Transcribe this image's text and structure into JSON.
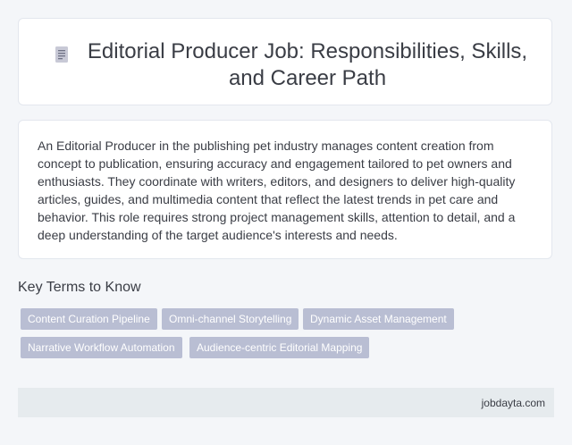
{
  "header": {
    "icon": "document-icon",
    "title": "Editorial Producer Job: Responsibilities, Skills, and Career Path"
  },
  "summary": {
    "text": "An Editorial Producer in the publishing pet industry manages content creation from concept to publication, ensuring accuracy and engagement tailored to pet owners and enthusiasts. They coordinate with writers, editors, and designers to deliver high-quality articles, guides, and multimedia content that reflect the latest trends in pet care and behavior. This role requires strong project management skills, attention to detail, and a deep understanding of the target audience's interests and needs."
  },
  "key_terms": {
    "heading": "Key Terms to Know",
    "tags": [
      "Content Curation Pipeline",
      "Omni-channel Storytelling",
      "Dynamic Asset Management",
      "Narrative Workflow Automation",
      "Audience-centric Editorial Mapping"
    ]
  },
  "footer": {
    "site": "jobdayta.com"
  },
  "colors": {
    "background": "#f4f6f9",
    "card": "#ffffff",
    "tag": "#b9bed3",
    "footer": "#e6ebee"
  }
}
